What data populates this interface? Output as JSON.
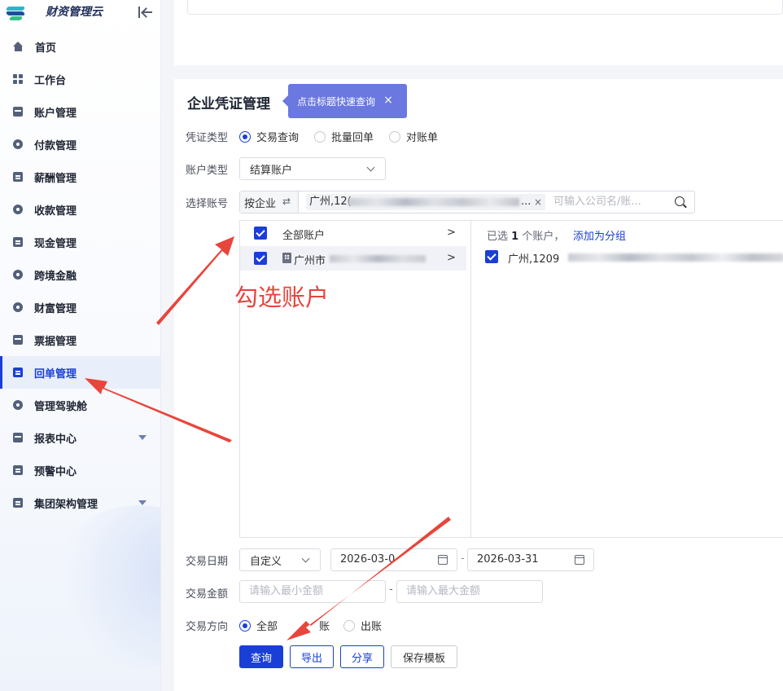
{
  "app": {
    "brand_name": "财资管理云"
  },
  "sidebar": {
    "items": [
      {
        "label": "首页",
        "icon": "home-icon"
      },
      {
        "label": "工作台",
        "icon": "grid-icon"
      },
      {
        "label": "账户管理",
        "icon": "card-icon"
      },
      {
        "label": "付款管理",
        "icon": "payment-icon"
      },
      {
        "label": "薪酬管理",
        "icon": "salary-icon"
      },
      {
        "label": "收款管理",
        "icon": "receive-icon"
      },
      {
        "label": "现金管理",
        "icon": "cash-icon"
      },
      {
        "label": "跨境金融",
        "icon": "globe-icon"
      },
      {
        "label": "财富管理",
        "icon": "wealth-icon"
      },
      {
        "label": "票据管理",
        "icon": "ticket-icon"
      },
      {
        "label": "回单管理",
        "icon": "receipt-icon",
        "active": true
      },
      {
        "label": "管理驾驶舱",
        "icon": "dashboard-icon"
      },
      {
        "label": "报表中心",
        "icon": "report-icon",
        "expandable": true
      },
      {
        "label": "预警中心",
        "icon": "alert-icon"
      },
      {
        "label": "集团架构管理",
        "icon": "org-icon",
        "expandable": true
      }
    ]
  },
  "page": {
    "title": "企业凭证管理",
    "tooltip": {
      "text": "点击标题快速查询",
      "close": "×"
    }
  },
  "form": {
    "voucher_type": {
      "label": "凭证类型",
      "options": [
        "交易查询",
        "批量回单",
        "对账单"
      ],
      "selected": "交易查询"
    },
    "account_type": {
      "label": "账户类型",
      "value": "结算账户"
    },
    "account_select": {
      "label": "选择账号",
      "mode": "按企业",
      "swap": "⇄",
      "tag": "广州,12(",
      "tag_suffix": "...",
      "tag_close": "×",
      "placeholder": "可输入公司名/账..."
    },
    "transfer": {
      "left_rows": [
        {
          "label": "全部账户",
          "arrow": ">",
          "checked": true
        },
        {
          "label": "广州市",
          "arrow": ">",
          "checked": true
        }
      ],
      "right_summary_prefix": "已选",
      "right_summary_count": "1",
      "right_summary_suffix": "个账户，",
      "add_group": "添加为分组",
      "selected_item": "广州,1209"
    },
    "trade_date": {
      "label": "交易日期",
      "mode": "自定义",
      "start": "2026-03-0",
      "end": "2026-03-31",
      "separator": "-"
    },
    "trade_amount": {
      "label": "交易金额",
      "min_placeholder": "请输入最小金额",
      "max_placeholder": "请输入最大金额",
      "separator": "-"
    },
    "trade_direction": {
      "label": "交易方向",
      "options": [
        "全部",
        "账",
        "出账"
      ],
      "selected": "全部"
    }
  },
  "buttons": {
    "query": "查询",
    "export": "导出",
    "share": "分享",
    "save_template": "保存模板"
  },
  "annotation": {
    "text": "勾选账户",
    "color": "#e8453c"
  },
  "colors": {
    "primary": "#1a3fd6",
    "tooltip": "#6a78e0"
  }
}
